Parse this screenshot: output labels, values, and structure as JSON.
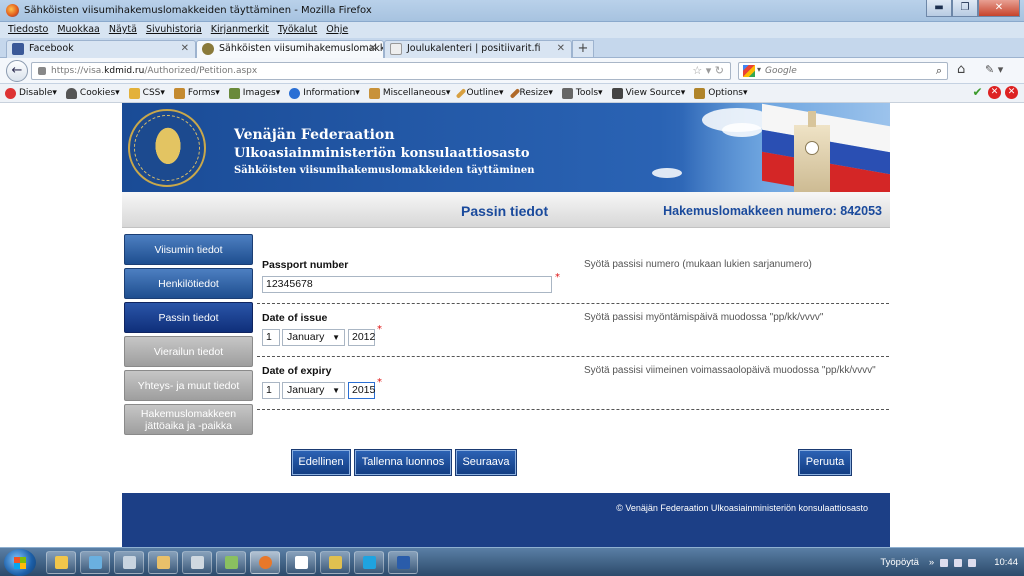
{
  "window": {
    "title": "Sähköisten viisumihakemuslomakkeiden täyttäminen - Mozilla Firefox",
    "minimize": "▬",
    "maximize": "❐",
    "close": "✕"
  },
  "menu": [
    "Tiedosto",
    "Muokkaa",
    "Näytä",
    "Sivuhistoria",
    "Kirjanmerkit",
    "Työkalut",
    "Ohje"
  ],
  "tabs": [
    {
      "label": "Facebook",
      "icon": "facebook-icon",
      "color": "#3b5998"
    },
    {
      "label": "Sähköisten viisumihakemuslomakkei...",
      "icon": "emblem-icon",
      "color": "#8a7a3a"
    },
    {
      "label": "Joulukalenteri | positiivarit.fi",
      "icon": "page-icon",
      "color": "#dddddd"
    }
  ],
  "nav": {
    "url_prefix": "https://visa.",
    "url_domain": "kdmid.ru",
    "url_path": "/Authorized/Petition.aspx",
    "search_placeholder": "Google"
  },
  "toolbar": [
    {
      "label": "Disable▾",
      "icon": "disable-icon",
      "color": "#d33"
    },
    {
      "label": "Cookies▾",
      "icon": "cookie-icon",
      "color": "#555"
    },
    {
      "label": "CSS▾",
      "icon": "css-icon",
      "color": "#e3b13a"
    },
    {
      "label": "Forms▾",
      "icon": "forms-icon",
      "color": "#c48a30"
    },
    {
      "label": "Images▾",
      "icon": "images-icon",
      "color": "#6a8a3a"
    },
    {
      "label": "Information▾",
      "icon": "information-icon",
      "color": "#2a6fd4"
    },
    {
      "label": "Miscellaneous▾",
      "icon": "miscellaneous-icon",
      "color": "#c8923a"
    },
    {
      "label": "Outline▾",
      "icon": "outline-icon",
      "color": "#d8a040"
    },
    {
      "label": "Resize▾",
      "icon": "resize-icon",
      "color": "#b06a2a"
    },
    {
      "label": "Tools▾",
      "icon": "tools-icon",
      "color": "#666"
    },
    {
      "label": "View Source▾",
      "icon": "view-source-icon",
      "color": "#444"
    },
    {
      "label": "Options▾",
      "icon": "options-icon",
      "color": "#b0842a"
    }
  ],
  "banner": {
    "line1": "Venäjän Federaation",
    "line2": "Ulkoasiainministeriön konsulaattiosasto",
    "line3": "Sähköisten viisumihakemuslomakkeiden täyttäminen"
  },
  "header": {
    "title": "Passin tiedot",
    "app_number": "Hakemuslomakkeen numero: 842053"
  },
  "sidenav": [
    {
      "label": "Viisumin tiedot",
      "state": "normal"
    },
    {
      "label": "Henkilötiedot",
      "state": "normal"
    },
    {
      "label": "Passin tiedot",
      "state": "active"
    },
    {
      "label": "Vierailun tiedot",
      "state": "disabled"
    },
    {
      "label": "Yhteys- ja muut tiedot",
      "state": "disabled"
    },
    {
      "label": "Hakemuslomakkeen jättöaika ja -paikka",
      "state": "disabled"
    }
  ],
  "form": {
    "passport": {
      "label": "Passport number",
      "value": "12345678",
      "hint": "Syötä passisi numero (mukaan lukien sarjanumero)",
      "req": "*"
    },
    "issue": {
      "label": "Date of issue",
      "day": "1",
      "month": "January",
      "year": "2012",
      "hint": "Syötä passisi myöntämispäivä muodossa \"pp/kk/vvvv\"",
      "req": "*"
    },
    "expiry": {
      "label": "Date of expiry",
      "day": "1",
      "month": "January",
      "year": "2015",
      "hint": "Syötä passisi viimeinen voimassaolopäivä muodossa \"pp/kk/vvvv\"",
      "req": "*"
    }
  },
  "buttons": {
    "prev": "Edellinen",
    "draft": "Tallenna luonnos",
    "next": "Seuraava",
    "cancel": "Peruuta"
  },
  "footer": {
    "copyright": "© Venäjän Federaation Ulkoasiainministeriön konsulaattiosasto"
  },
  "taskbar": {
    "desktop": "Työpöytä",
    "chevron": "»",
    "time": "10:44",
    "apps": [
      {
        "name": "explorer-app",
        "color": "#f1c64b"
      },
      {
        "name": "media-app",
        "color": "#6ab0e0"
      },
      {
        "name": "notepad-app",
        "color": "#c8d4e0"
      },
      {
        "name": "folder-app",
        "color": "#e8c06a"
      },
      {
        "name": "calc-app",
        "color": "#cfd8e0"
      },
      {
        "name": "network-app",
        "color": "#8ac060"
      },
      {
        "name": "firefox-app",
        "color": "#e8782a"
      },
      {
        "name": "bag-app",
        "color": "#ffffff"
      },
      {
        "name": "photo-app",
        "color": "#e0c050"
      },
      {
        "name": "skype-app",
        "color": "#1fa3e0"
      },
      {
        "name": "word-app",
        "color": "#2a5caa"
      }
    ]
  }
}
